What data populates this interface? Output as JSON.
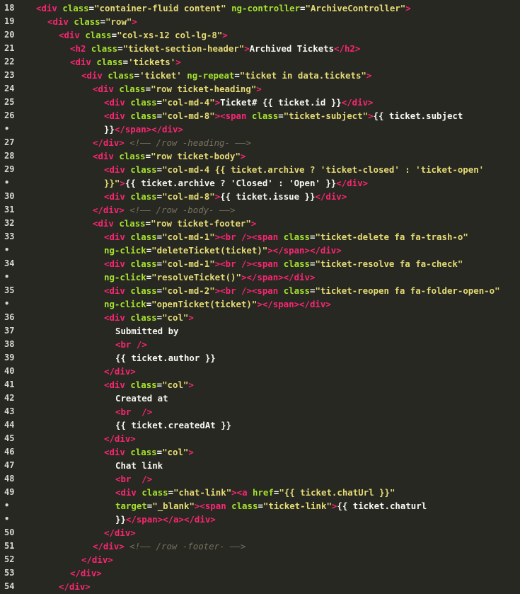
{
  "colors": {
    "background": "#272822",
    "tag": "#f92672",
    "attribute": "#a6e22e",
    "string": "#e6db74",
    "text": "#f8f8f2",
    "comment": "#75715e",
    "line_number": "#d8d8d0"
  },
  "lines": [
    {
      "num": "18",
      "indent": 0,
      "tokens": [
        [
          "tg",
          "<div "
        ],
        [
          "at",
          "class"
        ],
        [
          "tx",
          "="
        ],
        [
          "st",
          "\"container-fluid content\""
        ],
        [
          "tx",
          " "
        ],
        [
          "at",
          "ng-controller"
        ],
        [
          "tx",
          "="
        ],
        [
          "st",
          "\"ArchiveController\""
        ],
        [
          "tg",
          ">"
        ]
      ]
    },
    {
      "num": "19",
      "indent": 1,
      "tokens": [
        [
          "tg",
          "<div "
        ],
        [
          "at",
          "class"
        ],
        [
          "tx",
          "="
        ],
        [
          "st",
          "\"row\""
        ],
        [
          "tg",
          ">"
        ]
      ]
    },
    {
      "num": "20",
      "indent": 2,
      "tokens": [
        [
          "tg",
          "<div "
        ],
        [
          "at",
          "class"
        ],
        [
          "tx",
          "="
        ],
        [
          "st",
          "\"col-xs-12 col-lg-8\""
        ],
        [
          "tg",
          ">"
        ]
      ]
    },
    {
      "num": "21",
      "indent": 3,
      "tokens": [
        [
          "tg",
          "<h2 "
        ],
        [
          "at",
          "class"
        ],
        [
          "tx",
          "="
        ],
        [
          "st",
          "\"ticket-section-header\""
        ],
        [
          "tg",
          ">"
        ],
        [
          "tx",
          "Archived Tickets"
        ],
        [
          "tg",
          "</h2>"
        ]
      ]
    },
    {
      "num": "22",
      "indent": 3,
      "tokens": [
        [
          "tg",
          "<div "
        ],
        [
          "at",
          "class"
        ],
        [
          "tx",
          "="
        ],
        [
          "st",
          "'tickets'"
        ],
        [
          "tg",
          ">"
        ]
      ]
    },
    {
      "num": "23",
      "indent": 4,
      "tokens": [
        [
          "tg",
          "<div "
        ],
        [
          "at",
          "class"
        ],
        [
          "tx",
          "="
        ],
        [
          "st",
          "'ticket'"
        ],
        [
          "tx",
          " "
        ],
        [
          "at",
          "ng-repeat"
        ],
        [
          "tx",
          "="
        ],
        [
          "st",
          "\"ticket in data.tickets\""
        ],
        [
          "tg",
          ">"
        ]
      ]
    },
    {
      "num": "24",
      "indent": 5,
      "tokens": [
        [
          "tg",
          "<div "
        ],
        [
          "at",
          "class"
        ],
        [
          "tx",
          "="
        ],
        [
          "st",
          "\"row ticket-heading\""
        ],
        [
          "tg",
          ">"
        ]
      ]
    },
    {
      "num": "25",
      "indent": 6,
      "tokens": [
        [
          "tg",
          "<div "
        ],
        [
          "at",
          "class"
        ],
        [
          "tx",
          "="
        ],
        [
          "st",
          "\"col-md-4\""
        ],
        [
          "tg",
          ">"
        ],
        [
          "tx",
          "Ticket# {{ ticket.id }}"
        ],
        [
          "tg",
          "</div>"
        ]
      ]
    },
    {
      "num": "26",
      "indent": 6,
      "tokens": [
        [
          "tg",
          "<div "
        ],
        [
          "at",
          "class"
        ],
        [
          "tx",
          "="
        ],
        [
          "st",
          "\"col-md-8\""
        ],
        [
          "tg",
          "><span "
        ],
        [
          "at",
          "class"
        ],
        [
          "tx",
          "="
        ],
        [
          "st",
          "\"ticket-subject\""
        ],
        [
          "tg",
          ">"
        ],
        [
          "tx",
          "{{ ticket.subject"
        ]
      ]
    },
    {
      "num": "•",
      "indent": 6,
      "tokens": [
        [
          "tx",
          "}}"
        ],
        [
          "tg",
          "</span></div>"
        ]
      ]
    },
    {
      "num": "27",
      "indent": 5,
      "tokens": [
        [
          "tg",
          "</div>"
        ],
        [
          "tx",
          " "
        ],
        [
          "cm",
          "<!—— /row -heading- ——>"
        ]
      ]
    },
    {
      "num": "28",
      "indent": 5,
      "tokens": [
        [
          "tg",
          "<div "
        ],
        [
          "at",
          "class"
        ],
        [
          "tx",
          "="
        ],
        [
          "st",
          "\"row ticket-body\""
        ],
        [
          "tg",
          ">"
        ]
      ]
    },
    {
      "num": "29",
      "indent": 6,
      "tokens": [
        [
          "tg",
          "<div "
        ],
        [
          "at",
          "class"
        ],
        [
          "tx",
          "="
        ],
        [
          "st",
          "\"col-md-4 {{ ticket.archive ? 'ticket-closed' : 'ticket-open'"
        ]
      ]
    },
    {
      "num": "•",
      "indent": 6,
      "tokens": [
        [
          "st",
          "}}\""
        ],
        [
          "tg",
          ">"
        ],
        [
          "tx",
          "{{ ticket.archive ? 'Closed' : 'Open' }}"
        ],
        [
          "tg",
          "</div>"
        ]
      ]
    },
    {
      "num": "30",
      "indent": 6,
      "tokens": [
        [
          "tg",
          "<div "
        ],
        [
          "at",
          "class"
        ],
        [
          "tx",
          "="
        ],
        [
          "st",
          "\"col-md-8\""
        ],
        [
          "tg",
          ">"
        ],
        [
          "tx",
          "{{ ticket.issue }}"
        ],
        [
          "tg",
          "</div>"
        ]
      ]
    },
    {
      "num": "31",
      "indent": 5,
      "tokens": [
        [
          "tg",
          "</div>"
        ],
        [
          "tx",
          " "
        ],
        [
          "cm",
          "<!—— /row -body- ——>"
        ]
      ]
    },
    {
      "num": "32",
      "indent": 5,
      "tokens": [
        [
          "tg",
          "<div "
        ],
        [
          "at",
          "class"
        ],
        [
          "tx",
          "="
        ],
        [
          "st",
          "\"row ticket-footer\""
        ],
        [
          "tg",
          ">"
        ]
      ]
    },
    {
      "num": "33",
      "indent": 6,
      "tokens": [
        [
          "tg",
          "<div "
        ],
        [
          "at",
          "class"
        ],
        [
          "tx",
          "="
        ],
        [
          "st",
          "\"col-md-1\""
        ],
        [
          "tg",
          "><br /><span "
        ],
        [
          "at",
          "class"
        ],
        [
          "tx",
          "="
        ],
        [
          "st",
          "\"ticket-delete fa fa-trash-o\""
        ]
      ]
    },
    {
      "num": "•",
      "indent": 6,
      "tokens": [
        [
          "at",
          "ng-click"
        ],
        [
          "tx",
          "="
        ],
        [
          "st",
          "\"deleteTicket(ticket)\""
        ],
        [
          "tg",
          "></span></div>"
        ]
      ]
    },
    {
      "num": "34",
      "indent": 6,
      "tokens": [
        [
          "tg",
          "<div "
        ],
        [
          "at",
          "class"
        ],
        [
          "tx",
          "="
        ],
        [
          "st",
          "\"col-md-1\""
        ],
        [
          "tg",
          "><br /><span "
        ],
        [
          "at",
          "class"
        ],
        [
          "tx",
          "="
        ],
        [
          "st",
          "\"ticket-resolve fa fa-check\""
        ]
      ]
    },
    {
      "num": "•",
      "indent": 6,
      "tokens": [
        [
          "at",
          "ng-click"
        ],
        [
          "tx",
          "="
        ],
        [
          "st",
          "\"resolveTicket()\""
        ],
        [
          "tg",
          "></span></div>"
        ]
      ]
    },
    {
      "num": "35",
      "indent": 6,
      "tokens": [
        [
          "tg",
          "<div "
        ],
        [
          "at",
          "class"
        ],
        [
          "tx",
          "="
        ],
        [
          "st",
          "\"col-md-2\""
        ],
        [
          "tg",
          "><br /><span "
        ],
        [
          "at",
          "class"
        ],
        [
          "tx",
          "="
        ],
        [
          "st",
          "\"ticket-reopen fa fa-folder-open-o\""
        ]
      ]
    },
    {
      "num": "•",
      "indent": 6,
      "tokens": [
        [
          "at",
          "ng-click"
        ],
        [
          "tx",
          "="
        ],
        [
          "st",
          "\"openTicket(ticket)\""
        ],
        [
          "tg",
          "></span></div>"
        ]
      ]
    },
    {
      "num": "36",
      "indent": 6,
      "tokens": [
        [
          "tg",
          "<div "
        ],
        [
          "at",
          "class"
        ],
        [
          "tx",
          "="
        ],
        [
          "st",
          "\"col\""
        ],
        [
          "tg",
          ">"
        ]
      ]
    },
    {
      "num": "37",
      "indent": 7,
      "tokens": [
        [
          "tx",
          "Submitted by"
        ]
      ]
    },
    {
      "num": "38",
      "indent": 7,
      "tokens": [
        [
          "tg",
          "<br />"
        ]
      ]
    },
    {
      "num": "39",
      "indent": 7,
      "tokens": [
        [
          "tx",
          "{{ ticket.author }}"
        ]
      ]
    },
    {
      "num": "40",
      "indent": 6,
      "tokens": [
        [
          "tg",
          "</div>"
        ]
      ]
    },
    {
      "num": "41",
      "indent": 6,
      "tokens": [
        [
          "tg",
          "<div "
        ],
        [
          "at",
          "class"
        ],
        [
          "tx",
          "="
        ],
        [
          "st",
          "\"col\""
        ],
        [
          "tg",
          ">"
        ]
      ]
    },
    {
      "num": "42",
      "indent": 7,
      "tokens": [
        [
          "tx",
          "Created at"
        ]
      ]
    },
    {
      "num": "43",
      "indent": 7,
      "tokens": [
        [
          "tg",
          "<br  />"
        ]
      ]
    },
    {
      "num": "44",
      "indent": 7,
      "tokens": [
        [
          "tx",
          "{{ ticket.createdAt }}"
        ]
      ]
    },
    {
      "num": "45",
      "indent": 6,
      "tokens": [
        [
          "tg",
          "</div>"
        ]
      ]
    },
    {
      "num": "46",
      "indent": 6,
      "tokens": [
        [
          "tg",
          "<div "
        ],
        [
          "at",
          "class"
        ],
        [
          "tx",
          "="
        ],
        [
          "st",
          "\"col\""
        ],
        [
          "tg",
          ">"
        ]
      ]
    },
    {
      "num": "47",
      "indent": 7,
      "tokens": [
        [
          "tx",
          "Chat link"
        ]
      ]
    },
    {
      "num": "48",
      "indent": 7,
      "tokens": [
        [
          "tg",
          "<br  />"
        ]
      ]
    },
    {
      "num": "49",
      "indent": 7,
      "tokens": [
        [
          "tg",
          "<div "
        ],
        [
          "at",
          "class"
        ],
        [
          "tx",
          "="
        ],
        [
          "st",
          "\"chat-link\""
        ],
        [
          "tg",
          "><a "
        ],
        [
          "at",
          "href"
        ],
        [
          "tx",
          "="
        ],
        [
          "st",
          "\"{{ ticket.chatUrl }}\""
        ]
      ]
    },
    {
      "num": "•",
      "indent": 7,
      "tokens": [
        [
          "at",
          "target"
        ],
        [
          "tx",
          "="
        ],
        [
          "st",
          "\"_blank\""
        ],
        [
          "tg",
          "><span "
        ],
        [
          "at",
          "class"
        ],
        [
          "tx",
          "="
        ],
        [
          "st",
          "\"ticket-link\""
        ],
        [
          "tg",
          ">"
        ],
        [
          "tx",
          "{{ ticket.chaturl"
        ]
      ]
    },
    {
      "num": "•",
      "indent": 7,
      "tokens": [
        [
          "tx",
          "}}"
        ],
        [
          "tg",
          "</span></a></div>"
        ]
      ]
    },
    {
      "num": "50",
      "indent": 6,
      "tokens": [
        [
          "tg",
          "</div>"
        ]
      ]
    },
    {
      "num": "51",
      "indent": 5,
      "tokens": [
        [
          "tg",
          "</div>"
        ],
        [
          "tx",
          " "
        ],
        [
          "cm",
          "<!—— /row -footer- ——>"
        ]
      ]
    },
    {
      "num": "52",
      "indent": 4,
      "tokens": [
        [
          "tg",
          "</div>"
        ]
      ]
    },
    {
      "num": "53",
      "indent": 3,
      "tokens": [
        [
          "tg",
          "</div>"
        ]
      ]
    },
    {
      "num": "54",
      "indent": 2,
      "tokens": [
        [
          "tg",
          "</div>"
        ]
      ]
    }
  ]
}
